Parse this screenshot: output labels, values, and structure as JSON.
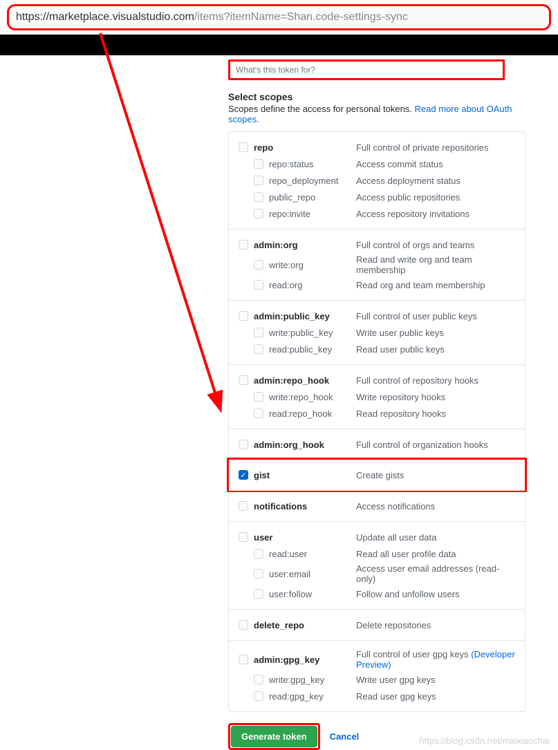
{
  "url": {
    "domain": "https://marketplace.visualstudio.com",
    "path": "/items?itemName=Shan.code-settings-sync"
  },
  "note": {
    "placeholder": "What's this token for?"
  },
  "scopes_header": "Select scopes",
  "scopes_desc": {
    "text": "Scopes define the access for personal tokens. ",
    "link": "Read more about OAuth scopes."
  },
  "scope_groups": [
    {
      "name": "repo",
      "desc": "Full control of private repositories",
      "children": [
        {
          "name": "repo:status",
          "desc": "Access commit status"
        },
        {
          "name": "repo_deployment",
          "desc": "Access deployment status"
        },
        {
          "name": "public_repo",
          "desc": "Access public repositories"
        },
        {
          "name": "repo:invite",
          "desc": "Access repository invitations"
        }
      ]
    },
    {
      "name": "admin:org",
      "desc": "Full control of orgs and teams",
      "children": [
        {
          "name": "write:org",
          "desc": "Read and write org and team membership"
        },
        {
          "name": "read:org",
          "desc": "Read org and team membership"
        }
      ]
    },
    {
      "name": "admin:public_key",
      "desc": "Full control of user public keys",
      "children": [
        {
          "name": "write:public_key",
          "desc": "Write user public keys"
        },
        {
          "name": "read:public_key",
          "desc": "Read user public keys"
        }
      ]
    },
    {
      "name": "admin:repo_hook",
      "desc": "Full control of repository hooks",
      "children": [
        {
          "name": "write:repo_hook",
          "desc": "Write repository hooks"
        },
        {
          "name": "read:repo_hook",
          "desc": "Read repository hooks"
        }
      ]
    },
    {
      "name": "admin:org_hook",
      "desc": "Full control of organization hooks",
      "children": []
    },
    {
      "name": "gist",
      "desc": "Create gists",
      "checked": true,
      "highlight": true,
      "children": []
    },
    {
      "name": "notifications",
      "desc": "Access notifications",
      "children": []
    },
    {
      "name": "user",
      "desc": "Update all user data",
      "children": [
        {
          "name": "read:user",
          "desc": "Read all user profile data"
        },
        {
          "name": "user:email",
          "desc": "Access user email addresses (read-only)"
        },
        {
          "name": "user:follow",
          "desc": "Follow and unfollow users"
        }
      ]
    },
    {
      "name": "delete_repo",
      "desc": "Delete repositories",
      "children": []
    },
    {
      "name": "admin:gpg_key",
      "desc": "Full control of user gpg keys ",
      "desc_link": "(Developer Preview)",
      "children": [
        {
          "name": "write:gpg_key",
          "desc": "Write user gpg keys"
        },
        {
          "name": "read:gpg_key",
          "desc": "Read user gpg keys"
        }
      ]
    }
  ],
  "actions": {
    "generate": "Generate token",
    "cancel": "Cancel"
  },
  "watermark": "https://blog.csdn.net/maixiaochai"
}
